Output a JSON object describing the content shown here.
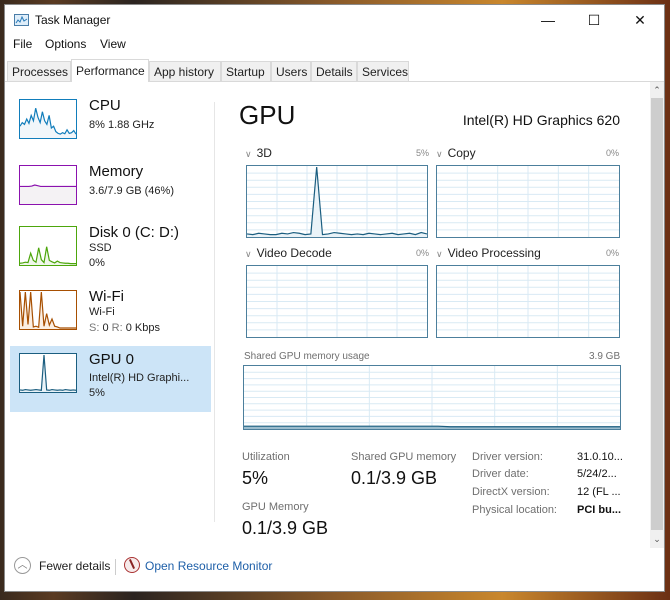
{
  "window": {
    "title": "Task Manager",
    "controls": {
      "minimize": "—",
      "maximize": "☐",
      "close": "✕"
    }
  },
  "menu": [
    "File",
    "Options",
    "View"
  ],
  "tabs": [
    {
      "label": "Processes",
      "active": false
    },
    {
      "label": "Performance",
      "active": true
    },
    {
      "label": "App history",
      "active": false
    },
    {
      "label": "Startup",
      "active": false
    },
    {
      "label": "Users",
      "active": false
    },
    {
      "label": "Details",
      "active": false
    },
    {
      "label": "Services",
      "active": false
    }
  ],
  "sidebar": {
    "items": [
      {
        "title": "CPU",
        "line1": "8% 1.88 GHz",
        "color": "#117dbb",
        "fill": "#f1f6fa",
        "active": false
      },
      {
        "title": "Memory",
        "line1": "3.6/7.9 GB (46%)",
        "color": "#8b12ae",
        "fill": "#f4f2f4",
        "active": false
      },
      {
        "title": "Disk 0 (C: D:)",
        "line1": "SSD",
        "line2": "0%",
        "color": "#4da60c",
        "fill": "#eff7ea",
        "active": false
      },
      {
        "title": "Wi-Fi",
        "line1": "Wi-Fi",
        "line2_label_s": "S:",
        "line2_value_s": "0",
        "line2_label_r": "R:",
        "line2_value_r": "0 Kbps",
        "color": "#a74f01",
        "fill": "#fbefe3",
        "active": false
      },
      {
        "title": "GPU 0",
        "line1": "Intel(R) HD Graphi...",
        "line2": "5%",
        "color": "#1b5e80",
        "fill": "#eaf3f8",
        "active": true
      }
    ]
  },
  "main": {
    "title": "GPU",
    "device": "Intel(R) HD Graphics 620",
    "engines": [
      {
        "label": "3D",
        "percent": "5%"
      },
      {
        "label": "Copy",
        "percent": "0%"
      },
      {
        "label": "Video Decode",
        "percent": "0%"
      },
      {
        "label": "Video Processing",
        "percent": "0%"
      }
    ],
    "shared_memory_chart": {
      "label": "Shared GPU memory usage",
      "max": "3.9 GB"
    },
    "stats": {
      "utilization_label": "Utilization",
      "utilization_value": "5%",
      "shared_label": "Shared GPU memory",
      "shared_value": "0.1/3.9 GB",
      "gpu_mem_label": "GPU Memory",
      "gpu_mem_value": "0.1/3.9 GB"
    },
    "info": [
      {
        "label": "Driver version:",
        "value": "31.0.10..."
      },
      {
        "label": "Driver date:",
        "value": "5/24/2..."
      },
      {
        "label": "DirectX version:",
        "value": "12 (FL ..."
      },
      {
        "label": "Physical location:",
        "value": "PCI bu..."
      }
    ]
  },
  "footer": {
    "fewer_details": "Fewer details",
    "open_resource_monitor": "Open Resource Monitor"
  },
  "series": {
    "cpu": [
      30,
      40,
      35,
      50,
      38,
      60,
      45,
      80,
      55,
      40,
      70,
      45,
      35,
      60,
      25,
      30,
      15,
      10,
      8,
      12,
      9,
      20,
      10,
      12,
      18,
      8
    ],
    "memory": [
      46,
      46,
      46,
      46,
      47,
      50,
      48,
      46,
      46,
      46,
      46,
      46,
      46,
      46,
      46,
      46,
      46,
      46,
      46,
      46
    ],
    "disk": [
      2,
      3,
      5,
      4,
      30,
      10,
      5,
      45,
      12,
      4,
      48,
      10,
      6,
      3,
      8,
      4,
      3,
      2,
      2,
      1,
      1,
      1
    ],
    "wifi": [
      100,
      5,
      100,
      10,
      100,
      3,
      5,
      2,
      100,
      5,
      40,
      8,
      25,
      5,
      3,
      0,
      0,
      0,
      0,
      0,
      0,
      0
    ],
    "gpu_thumb": [
      3,
      2,
      4,
      3,
      2,
      3,
      4,
      3,
      2,
      100,
      3,
      2,
      4,
      3,
      2,
      3,
      2,
      4,
      3,
      2,
      3,
      2
    ],
    "gpu_3d": [
      3,
      2,
      4,
      3,
      2,
      2,
      4,
      3,
      5,
      4,
      2,
      3,
      100,
      2,
      3,
      5,
      4,
      3,
      2,
      3,
      2,
      4,
      3,
      2,
      3,
      4,
      2,
      3,
      4,
      2,
      5,
      3
    ],
    "shared_mem": [
      3,
      3,
      3,
      3,
      3,
      3,
      3,
      3,
      3,
      3,
      3,
      3,
      3,
      3,
      3,
      3,
      3,
      2,
      2,
      2,
      2,
      2,
      2,
      2,
      2,
      2,
      2,
      2,
      2,
      2,
      2,
      2
    ]
  }
}
